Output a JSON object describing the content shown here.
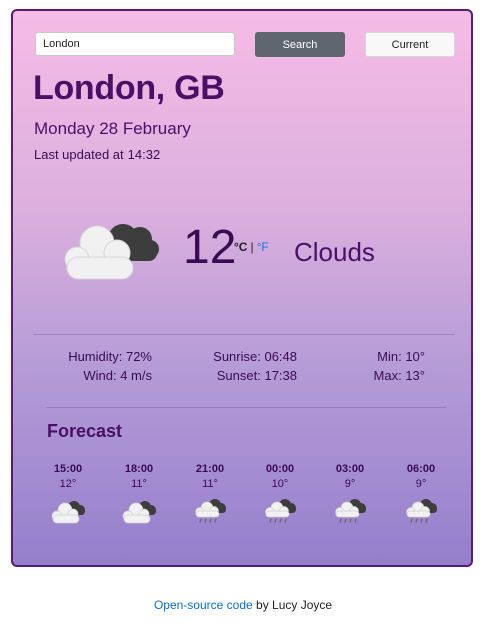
{
  "search": {
    "input_value": "London",
    "search_label": "Search",
    "current_label": "Current"
  },
  "location": {
    "city": "London, GB",
    "date": "Monday 28 February",
    "updated_label": "Last updated at",
    "updated_time": "14:32"
  },
  "current": {
    "temperature": "12",
    "unit_c": "°C",
    "unit_sep": "|",
    "unit_f": "°F",
    "description": "Clouds",
    "icon": "broken-clouds-icon"
  },
  "details": {
    "humidity": "Humidity: 72%",
    "wind": "Wind: 4 m/s",
    "sunrise": "Sunrise: 06:48",
    "sunset": "Sunset: 17:38",
    "min": "Min: 10°",
    "max": "Max: 13°"
  },
  "forecast": {
    "title": "Forecast",
    "items": [
      {
        "time": "15:00",
        "temp": "12°",
        "icon": "broken-clouds-icon"
      },
      {
        "time": "18:00",
        "temp": "11°",
        "icon": "broken-clouds-icon"
      },
      {
        "time": "21:00",
        "temp": "11°",
        "icon": "rain-cloud-icon"
      },
      {
        "time": "00:00",
        "temp": "10°",
        "icon": "rain-cloud-icon"
      },
      {
        "time": "03:00",
        "temp": "9°",
        "icon": "rain-cloud-icon"
      },
      {
        "time": "06:00",
        "temp": "9°",
        "icon": "rain-cloud-icon"
      }
    ]
  },
  "footer": {
    "link_text": "Open-source code",
    "by_text": "by Lucy Joyce"
  },
  "colors": {
    "accent": "#4a0f66",
    "link": "#1a73e8"
  }
}
